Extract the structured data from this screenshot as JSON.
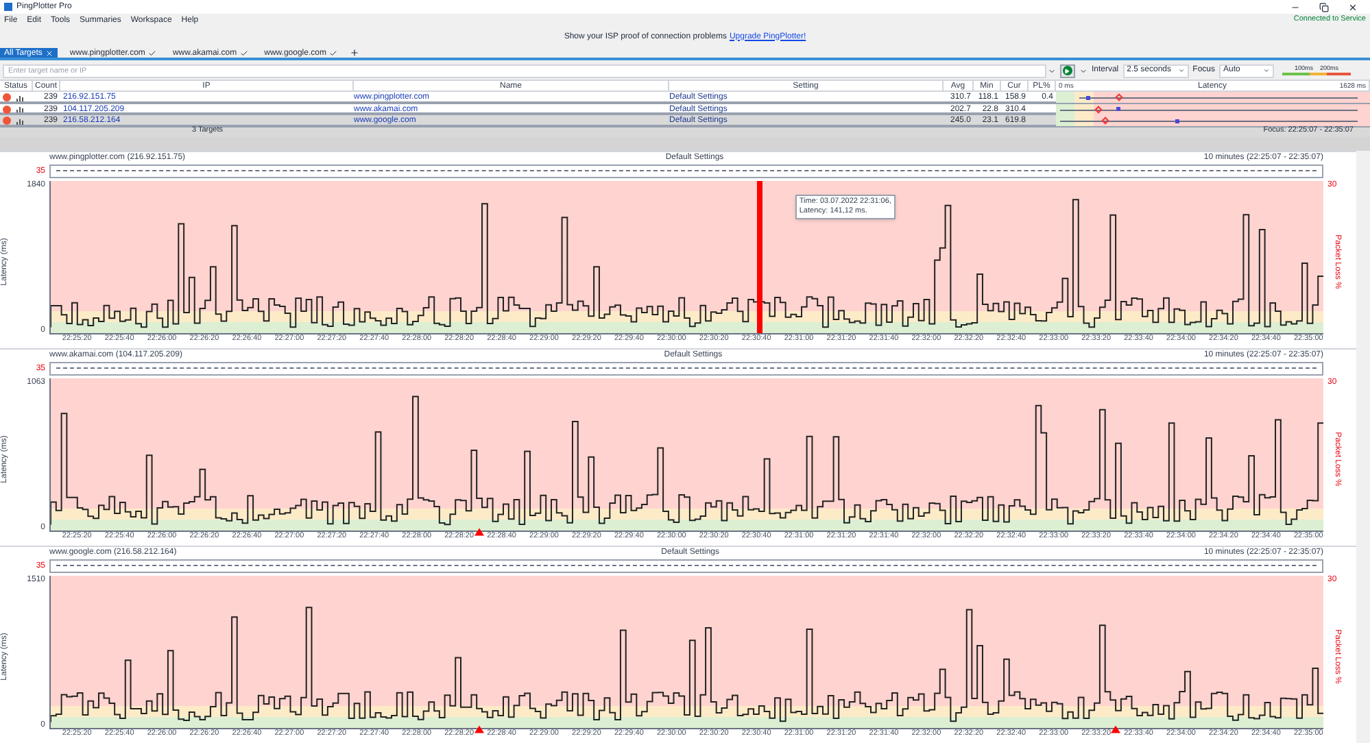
{
  "window": {
    "title": "PingPlotter Pro"
  },
  "menu": [
    "File",
    "Edit",
    "Tools",
    "Summaries",
    "Workspace",
    "Help"
  ],
  "service_status": "Connected to Service",
  "banner": {
    "text": "Show your ISP proof of connection problems",
    "link": "Upgrade PingPlotter!"
  },
  "tabs": [
    {
      "label": "All Targets",
      "selected": true
    },
    {
      "label": "www.pingplotter.com",
      "selected": false
    },
    {
      "label": "www.akamai.com",
      "selected": false
    },
    {
      "label": "www.google.com",
      "selected": false
    }
  ],
  "toolbar": {
    "placeholder": "Enter target name or IP",
    "interval_label": "Interval",
    "interval": "2.5 seconds",
    "focus_label": "Focus",
    "focus": "Auto",
    "legend": [
      "100ms",
      "200ms"
    ]
  },
  "table": {
    "columns": [
      "Status",
      "Count",
      "IP",
      "Name",
      "Setting",
      "Avg",
      "Min",
      "Cur",
      "PL%",
      "Latency"
    ],
    "latency_min": "0 ms",
    "latency_max": "1628 ms",
    "rows": [
      {
        "count": "239",
        "ip": "216.92.151.75",
        "name": "www.pingplotter.com",
        "setting": "Default Settings",
        "avg": "310.7",
        "min": "118.1",
        "cur": "158.9",
        "pl": "0.4",
        "selected": false
      },
      {
        "count": "239",
        "ip": "104.117.205.209",
        "name": "www.akamai.com",
        "setting": "Default Settings",
        "avg": "202.7",
        "min": "22.8",
        "cur": "310.4",
        "selected": false
      },
      {
        "count": "239",
        "ip": "216.58.212.164",
        "name": "www.google.com",
        "setting": "Default Settings",
        "avg": "245.0",
        "min": "23.1",
        "cur": "619.8",
        "selected": true
      }
    ]
  },
  "footer": {
    "count": "3 Targets",
    "focus": "Focus: 22:25:07 - 22:35:07"
  },
  "graphs": [
    {
      "target": "www.pingplotter.com (216.92.151.75)",
      "setting": "Default Settings",
      "range": "10 minutes (22:25:07 - 22:35:07)",
      "pl_max": "35",
      "y_max": "1840",
      "y_min": "0",
      "y_label": "Latency (ms)",
      "pl_label": "Packet Loss %",
      "pl_axis": "30",
      "tooltip": [
        "Time: 03.07.2022 22:31:06,",
        "Latency: 141,12 ms."
      ],
      "ticks": [
        {
          "label": "22:25:20",
          "kind": "plain"
        },
        {
          "label": "22:25:40",
          "kind": "plain"
        },
        {
          "label": "22:26:00",
          "kind": "plain"
        },
        {
          "label": "22:26:20",
          "kind": "plain"
        },
        {
          "label": "22:26:40",
          "kind": "plain"
        },
        {
          "label": "22:27:00",
          "kind": "plain"
        },
        {
          "label": "22:27:20",
          "kind": "plain"
        },
        {
          "label": "22:27:40",
          "kind": "plain"
        },
        {
          "label": "22:28:00",
          "kind": "plain"
        },
        {
          "label": "22:28:20",
          "kind": "plain"
        },
        {
          "label": "22:28:40",
          "kind": "plain"
        },
        {
          "label": "22:29:00",
          "kind": "plain"
        },
        {
          "label": "22:29:20",
          "kind": "plain"
        },
        {
          "label": "22:29:40",
          "kind": "plain"
        },
        {
          "label": "22:30:00",
          "kind": "plain"
        },
        {
          "label": "22:30:20",
          "kind": "plain"
        },
        {
          "label": "22:30:40",
          "kind": "cursor"
        },
        {
          "label": "22:31:00",
          "kind": "plain"
        },
        {
          "label": "22:31:20",
          "kind": "plain"
        },
        {
          "label": "22:31:40",
          "kind": "plain"
        },
        {
          "label": "22:32:00",
          "kind": "plain"
        },
        {
          "label": "22:32:20",
          "kind": "plain"
        },
        {
          "label": "22:32:40",
          "kind": "plain"
        },
        {
          "label": "22:33:00",
          "kind": "plain"
        },
        {
          "label": "22:33:20",
          "kind": "plain"
        },
        {
          "label": "22:33:40",
          "kind": "plain"
        },
        {
          "label": "22:34:00",
          "kind": "plain"
        },
        {
          "label": "22:34:20",
          "kind": "plain"
        },
        {
          "label": "22:34:40",
          "kind": "plain"
        },
        {
          "label": "22:35:00",
          "kind": "plain"
        }
      ]
    },
    {
      "target": "www.akamai.com (104.117.205.209)",
      "setting": "Default Settings",
      "range": "10 minutes (22:25:07 - 22:35:07)",
      "pl_max": "35",
      "y_max": "1063",
      "y_min": "0",
      "y_label": "Latency (ms)",
      "pl_label": "Packet Loss %",
      "pl_axis": "30",
      "ticks": [
        {
          "label": "22:25:20",
          "kind": "plain"
        },
        {
          "label": "22:25:40",
          "kind": "plain"
        },
        {
          "label": "22:26:00",
          "kind": "plain"
        },
        {
          "label": "22:26:20",
          "kind": "plain"
        },
        {
          "label": "22:26:40",
          "kind": "plain"
        },
        {
          "label": "22:27:00",
          "kind": "plain"
        },
        {
          "label": "22:27:20",
          "kind": "plain"
        },
        {
          "label": "22:27:40",
          "kind": "plain"
        },
        {
          "label": "22:28:00",
          "kind": "plain"
        },
        {
          "label": "22:28:20",
          "kind": "plain"
        },
        {
          "label": "22:28:40",
          "kind": "loss"
        },
        {
          "label": "22:29:00",
          "kind": "plain"
        },
        {
          "label": "22:29:20",
          "kind": "plain"
        },
        {
          "label": "22:29:40",
          "kind": "plain"
        },
        {
          "label": "22:30:00",
          "kind": "plain"
        },
        {
          "label": "22:30:20",
          "kind": "plain"
        },
        {
          "label": "22:30:40",
          "kind": "plain"
        },
        {
          "label": "22:31:00",
          "kind": "plain"
        },
        {
          "label": "22:31:20",
          "kind": "plain"
        },
        {
          "label": "22:31:40",
          "kind": "plain"
        },
        {
          "label": "22:32:00",
          "kind": "plain"
        },
        {
          "label": "22:32:20",
          "kind": "plain"
        },
        {
          "label": "22:32:40",
          "kind": "plain"
        },
        {
          "label": "22:33:00",
          "kind": "plain"
        },
        {
          "label": "22:33:20",
          "kind": "plain"
        },
        {
          "label": "22:33:40",
          "kind": "plain"
        },
        {
          "label": "22:34:00",
          "kind": "plain"
        },
        {
          "label": "22:34:20",
          "kind": "plain"
        },
        {
          "label": "22:34:40",
          "kind": "plain"
        },
        {
          "label": "22:35:00",
          "kind": "plain"
        }
      ]
    },
    {
      "target": "www.google.com (216.58.212.164)",
      "setting": "Default Settings",
      "range": "10 minutes (22:25:07 - 22:35:07)",
      "pl_max": "35",
      "y_max": "1510",
      "y_min": "0",
      "y_label": "Latency (ms)",
      "pl_label": "Packet Loss %",
      "pl_axis": "30",
      "ticks": [
        {
          "label": "22:25:20",
          "kind": "plain"
        },
        {
          "label": "22:25:40",
          "kind": "plain"
        },
        {
          "label": "22:26:00",
          "kind": "plain"
        },
        {
          "label": "22:26:20",
          "kind": "plain"
        },
        {
          "label": "22:26:40",
          "kind": "plain"
        },
        {
          "label": "22:27:00",
          "kind": "plain"
        },
        {
          "label": "22:27:20",
          "kind": "plain"
        },
        {
          "label": "22:27:40",
          "kind": "plain"
        },
        {
          "label": "22:28:00",
          "kind": "plain"
        },
        {
          "label": "22:28:20",
          "kind": "plain"
        },
        {
          "label": "22:28:40",
          "kind": "loss"
        },
        {
          "label": "22:29:00",
          "kind": "plain"
        },
        {
          "label": "22:29:20",
          "kind": "plain"
        },
        {
          "label": "22:29:40",
          "kind": "plain"
        },
        {
          "label": "22:30:00",
          "kind": "plain"
        },
        {
          "label": "22:30:20",
          "kind": "plain"
        },
        {
          "label": "22:30:40",
          "kind": "plain"
        },
        {
          "label": "22:31:00",
          "kind": "plain"
        },
        {
          "label": "22:31:20",
          "kind": "plain"
        },
        {
          "label": "22:31:40",
          "kind": "plain"
        },
        {
          "label": "22:32:00",
          "kind": "plain"
        },
        {
          "label": "22:32:20",
          "kind": "plain"
        },
        {
          "label": "22:32:40",
          "kind": "plain"
        },
        {
          "label": "22:33:00",
          "kind": "plain"
        },
        {
          "label": "22:33:20",
          "kind": "plain"
        },
        {
          "label": "22:33:40",
          "kind": "loss"
        },
        {
          "label": "22:34:00",
          "kind": "plain"
        },
        {
          "label": "22:34:20",
          "kind": "plain"
        },
        {
          "label": "22:34:40",
          "kind": "plain"
        },
        {
          "label": "22:35:00",
          "kind": "plain"
        }
      ]
    }
  ]
}
